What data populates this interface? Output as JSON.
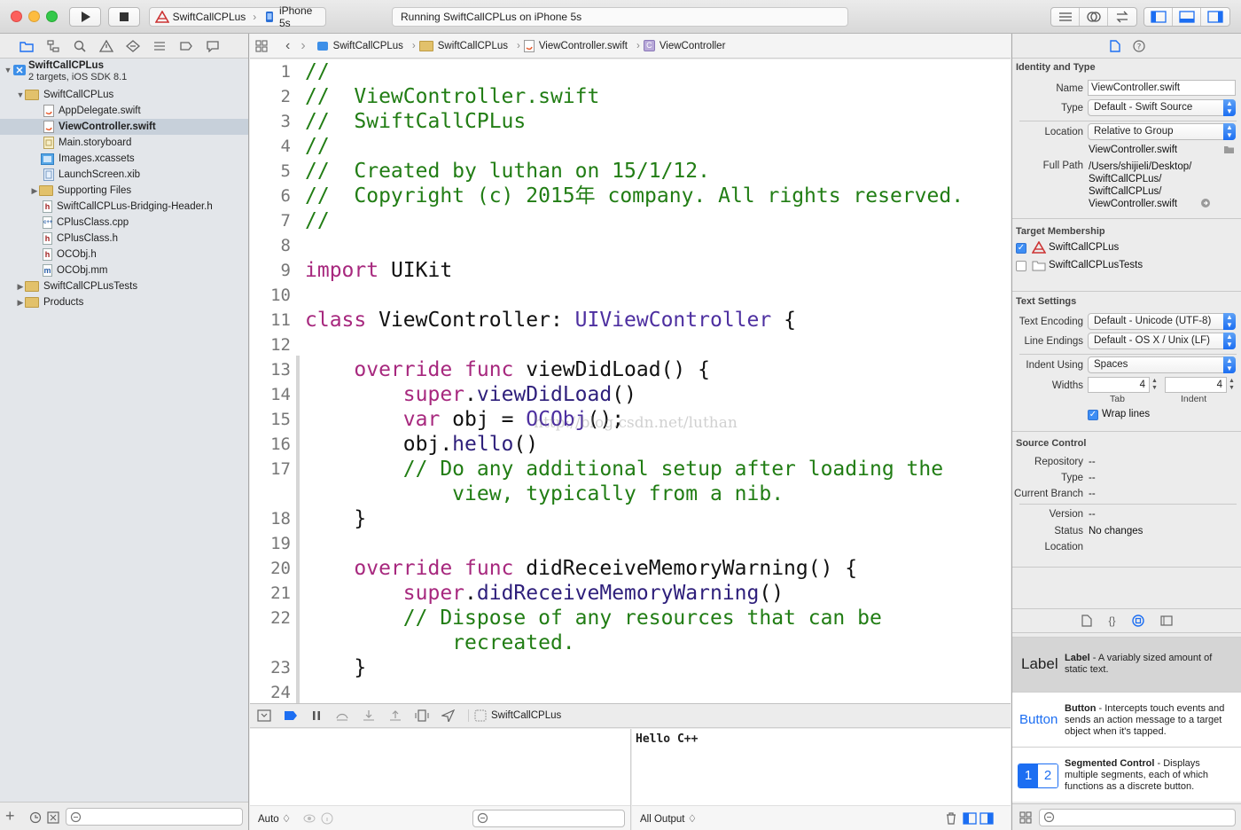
{
  "toolbar": {
    "scheme": "SwiftCallCPLus",
    "device": "iPhone 5s",
    "activity": "Running SwiftCallCPLus on iPhone 5s"
  },
  "navigator": {
    "items": [
      {
        "label": "SwiftCallCPLus",
        "sub": "2 targets, iOS SDK 8.1",
        "kind": "project"
      },
      {
        "label": "SwiftCallCPLus",
        "kind": "folder"
      },
      {
        "label": "AppDelegate.swift",
        "kind": "swift"
      },
      {
        "label": "ViewController.swift",
        "kind": "swift",
        "selected": true
      },
      {
        "label": "Main.storyboard",
        "kind": "storyboard"
      },
      {
        "label": "Images.xcassets",
        "kind": "assets"
      },
      {
        "label": "LaunchScreen.xib",
        "kind": "xib"
      },
      {
        "label": "Supporting Files",
        "kind": "folder"
      },
      {
        "label": "SwiftCallCPLus-Bridging-Header.h",
        "kind": "h",
        "glyph": "h"
      },
      {
        "label": "CPlusClass.cpp",
        "kind": "cpp",
        "glyph": "c++"
      },
      {
        "label": "CPlusClass.h",
        "kind": "h",
        "glyph": "h"
      },
      {
        "label": "OCObj.h",
        "kind": "h",
        "glyph": "h"
      },
      {
        "label": "OCObj.mm",
        "kind": "mm",
        "glyph": "m"
      },
      {
        "label": "SwiftCallCPLusTests",
        "kind": "folder"
      },
      {
        "label": "Products",
        "kind": "folder"
      }
    ]
  },
  "jumpbar": {
    "crumbs": [
      "SwiftCallCPLus",
      "SwiftCallCPLus",
      "ViewController.swift",
      "ViewController"
    ]
  },
  "editor": {
    "line_numbers": [
      "1",
      "2",
      "3",
      "4",
      "5",
      "6",
      "7",
      "8",
      "9",
      "10",
      "11",
      "12",
      "13",
      "14",
      "15",
      "16",
      "17",
      "18",
      "19",
      "20",
      "21",
      "22",
      "23",
      "24"
    ],
    "watermark": "http://blog.csdn.net/luthan"
  },
  "debug": {
    "target": "SwiftCallCPLus",
    "console_output": "Hello C++",
    "auto_label": "Auto ♢",
    "all_output_label": "All Output ♢"
  },
  "inspector": {
    "identity_title": "Identity and Type",
    "name_label": "Name",
    "name_value": "ViewController.swift",
    "type_label": "Type",
    "type_value": "Default - Swift Source",
    "location_label": "Location",
    "location_value": "Relative to Group",
    "location_file": "ViewController.swift",
    "fullpath_label": "Full Path",
    "fullpath_lines": [
      "/Users/shijieli/Desktop/",
      "SwiftCallCPLus/",
      "SwiftCallCPLus/",
      "ViewController.swift"
    ],
    "membership_title": "Target Membership",
    "targets": [
      {
        "label": "SwiftCallCPLus",
        "checked": true
      },
      {
        "label": "SwiftCallCPLusTests",
        "checked": false
      }
    ],
    "text_title": "Text Settings",
    "encoding_label": "Text Encoding",
    "encoding_value": "Default - Unicode (UTF-8)",
    "endings_label": "Line Endings",
    "endings_value": "Default - OS X / Unix (LF)",
    "indent_label": "Indent Using",
    "indent_value": "Spaces",
    "widths_label": "Widths",
    "tab_value": "4",
    "indent_width_value": "4",
    "tab_caption": "Tab",
    "indent_caption": "Indent",
    "wrap_label": "Wrap lines",
    "sc_title": "Source Control",
    "repository_label": "Repository",
    "repository_value": "--",
    "sctype_label": "Type",
    "sctype_value": "--",
    "branch_label": "Current Branch",
    "branch_value": "--",
    "version_label": "Version",
    "version_value": "--",
    "status_label": "Status",
    "status_value": "No changes",
    "sclocation_label": "Location"
  },
  "library": [
    {
      "preview": "Label",
      "title": "Label",
      "desc": " - A variably sized amount of static text."
    },
    {
      "preview": "Button",
      "title": "Button",
      "desc": " - Intercepts touch events and sends an action message to a target object when it's tapped."
    },
    {
      "preview_segments": [
        "1",
        "2"
      ],
      "title": "Segmented Control",
      "desc": " - Displays multiple segments, each of which functions as a discrete button."
    }
  ],
  "colors": {
    "accent": "#1c6ef2",
    "keyword": "#a7287e",
    "comment": "#217d14",
    "type": "#4d2fa0"
  }
}
